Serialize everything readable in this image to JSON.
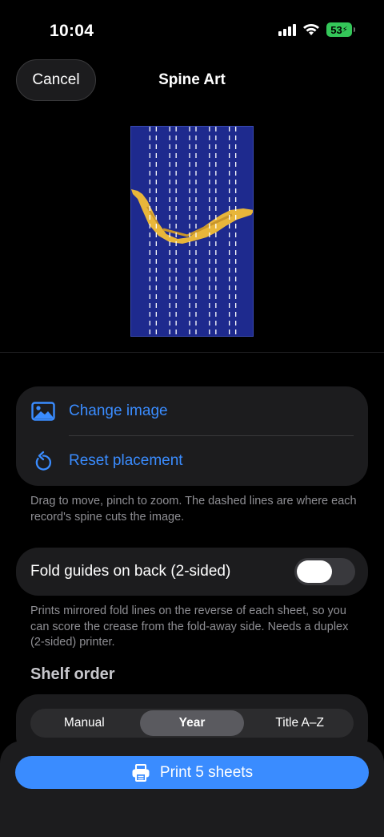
{
  "status_bar": {
    "time": "10:04",
    "battery": "53",
    "icons": [
      "cellular-signal-icon",
      "wifi-icon",
      "battery-charging-icon"
    ]
  },
  "nav": {
    "cancel_label": "Cancel",
    "title": "Spine Art"
  },
  "preview": {
    "background_color": "#1e2a8e",
    "spine_cuts": 5
  },
  "image_actions": {
    "change_image_label": "Change image",
    "reset_placement_label": "Reset placement",
    "accent": "#3a8cff"
  },
  "image_caption": "Drag to move, pinch to zoom. The dashed lines are where each record's spine cuts the image.",
  "fold_guides": {
    "label": "Fold guides on back (2-sided)",
    "enabled": false
  },
  "fold_caption": "Prints mirrored fold lines on the reverse of each sheet, so you can score the crease from the fold-away side. Needs a duplex (2-sided) printer.",
  "shelf_order": {
    "heading": "Shelf order",
    "options": [
      "Manual",
      "Year",
      "Title A–Z"
    ],
    "selected": "Year"
  },
  "print_button": {
    "label": "Print 5 sheets",
    "icon": "printer-icon"
  }
}
